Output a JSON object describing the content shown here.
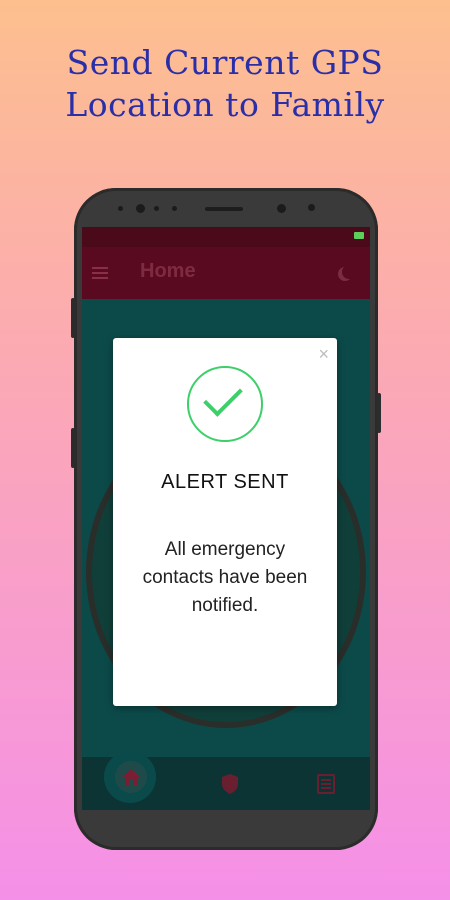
{
  "headline": {
    "line1": "Send Current GPS",
    "line2": "Location to Family"
  },
  "app": {
    "appbar": {
      "title": "Home"
    },
    "dialog": {
      "title": "ALERT SENT",
      "message": "All emergency contacts have been notified.",
      "close_glyph": "×"
    },
    "bottom_nav": [
      {
        "name": "home",
        "icon": "home-icon",
        "selected": true
      },
      {
        "name": "shield",
        "icon": "shield-icon",
        "selected": false
      },
      {
        "name": "contacts",
        "icon": "list-icon",
        "selected": false
      }
    ]
  },
  "colors": {
    "headline": "#2a2fa8",
    "accent_green": "#3ccf6a",
    "appbar_bg": "#5a0a20",
    "screen_bg": "#0c4a4a"
  }
}
